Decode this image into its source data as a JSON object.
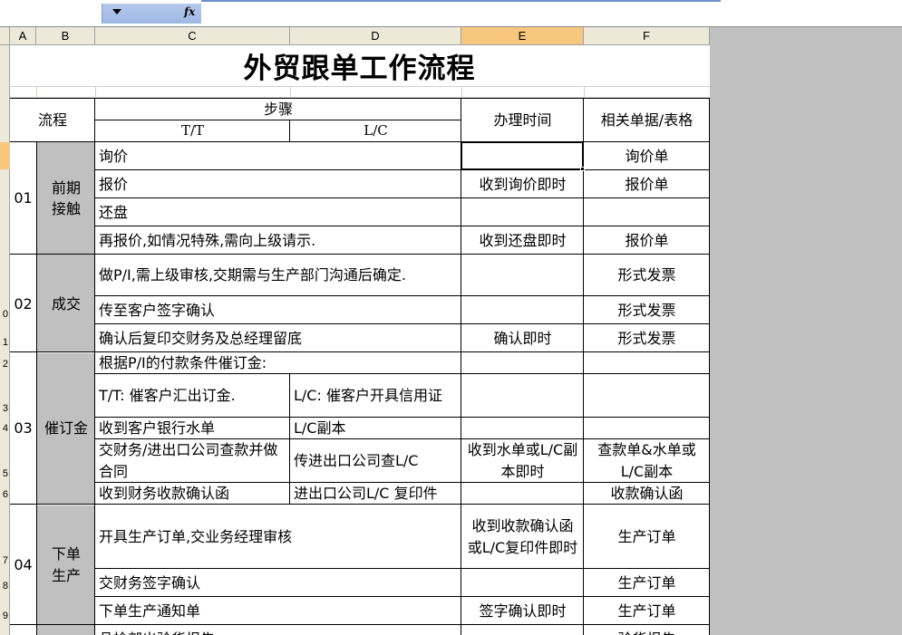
{
  "toolbar": {
    "fx_label": "fx"
  },
  "columns": [
    "A",
    "B",
    "C",
    "D",
    "E",
    "F"
  ],
  "selected_column": "E",
  "row_numbers": [
    "0",
    "1",
    "2",
    "3",
    "4",
    "5",
    "6",
    "7",
    "8",
    "9"
  ],
  "title": "外贸跟单工作流程",
  "header": {
    "process": "流程",
    "steps": "步骤",
    "tt": "T/T",
    "lc": "L/C",
    "time": "办理时间",
    "docs": "相关单据/表格"
  },
  "groups": [
    {
      "no": "01",
      "name": "前期接触"
    },
    {
      "no": "02",
      "name": "成交"
    },
    {
      "no": "03",
      "name": "催订金"
    },
    {
      "no": "04",
      "name": "下单生产"
    }
  ],
  "rows": {
    "r1_step": "询价",
    "r1_doc": "询价单",
    "r2_step": "报价",
    "r2_time": "收到询价即时",
    "r2_doc": "报价单",
    "r3_step": "还盘",
    "r4_step": "再报价,如情况特殊,需向上级请示.",
    "r4_time": "收到还盘即时",
    "r4_doc": "报价单",
    "r5_step": "做P/I,需上级审核,交期需与生产部门沟通后确定.",
    "r5_doc": "形式发票",
    "r6_step": "传至客户签字确认",
    "r6_doc": "形式发票",
    "r7_step": "确认后复印交财务及总经理留底",
    "r7_time": "确认即时",
    "r7_doc": "形式发票",
    "r8_step": "根据P/I的付款条件催订金:",
    "r9_tt": "T/T: 催客户汇出订金.",
    "r9_lc": "L/C: 催客户开具信用证",
    "r10_tt": "收到客户银行水单",
    "r10_lc": "L/C副本",
    "r11_tt": "交财务/进出口公司查款并做合同",
    "r11_lc": "传进出口公司查L/C",
    "r11_time": "收到水单或L/C副本即时",
    "r11_doc": "查款单&水单或L/C副本",
    "r12_tt": "收到财务收款确认函",
    "r12_lc": "进出口公司L/C 复印件",
    "r12_doc": "收款确认函",
    "r13_step": "开具生产订单,交业务经理审核",
    "r13_time": "收到收款确认函或L/C复印件即时",
    "r13_doc": "生产订单",
    "r14_step": "交财务签字确认",
    "r14_doc": "生产订单",
    "r15_step": "下单生产通知单",
    "r15_time": "签字确认即时",
    "r15_doc": "生产订单",
    "r16_step": "品检部出验货报告",
    "r16_doc": "验货报告"
  }
}
